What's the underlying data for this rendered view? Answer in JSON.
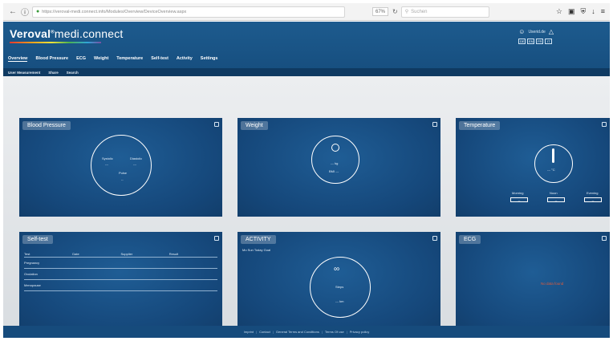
{
  "browser": {
    "url": "https://veroval-medi.connect.info/Modules/Overview/DeviceOverview.aspx",
    "zoom": "67%",
    "search_placeholder": "Suchen"
  },
  "app": {
    "brand_prefix": "Veroval",
    "brand_reg": "®",
    "brand_suffix": "medi.connect",
    "user_label": "Userid.de",
    "lang_flags": [
      "DE",
      "EN",
      "FR",
      "IT"
    ]
  },
  "nav": [
    "Overview",
    "Blood Pressure",
    "ECG",
    "Weight",
    "Temperature",
    "Self-test",
    "Activity",
    "Settings"
  ],
  "subnav": [
    "User Measurement",
    "Share",
    "Search"
  ],
  "cards": {
    "bp": {
      "title": "Blood Pressure",
      "sys_label": "Systolic",
      "dia_label": "Diastolic",
      "pulse_label": "Pulse",
      "sys_value": "---",
      "dia_value": "---",
      "pulse_value": "--"
    },
    "weight": {
      "title": "Weight",
      "value": "--- kg",
      "bmi": "BMI ---"
    },
    "temperature": {
      "title": "Temperature",
      "value": "--- °C",
      "labels": [
        "Morning",
        "Noon",
        "Evening"
      ],
      "values": [
        "--",
        "--",
        "--"
      ]
    },
    "selftest": {
      "title": "Self-test",
      "headers": [
        "Test",
        "Date",
        "Supplier",
        "Result"
      ],
      "rows": [
        "Pregnancy",
        "Ovulation",
        "Menopause"
      ]
    },
    "activity": {
      "title": "ACTIVITY",
      "tabs_text": "Mo    Sun   Today   Goal",
      "steps": "Steps",
      "distance": "--- km"
    },
    "ecg": {
      "title": "ECG",
      "no_data": "No data found"
    }
  },
  "footer": [
    "Imprint",
    "Contact",
    "General Terms and Conditions",
    "Terms Of use",
    "Privacy policy"
  ],
  "colors": {
    "header_blue": "#1d5b8e",
    "card_blue": "#15477a",
    "ecg_red": "#e05a3a"
  }
}
